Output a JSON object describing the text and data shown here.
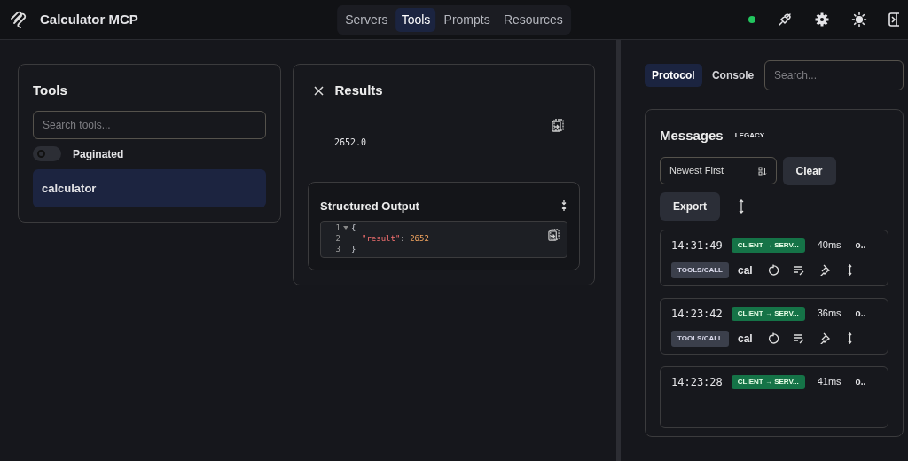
{
  "app": {
    "title": "Calculator MCP"
  },
  "nav_tabs": [
    {
      "label": "Servers",
      "selected": false
    },
    {
      "label": "Tools",
      "selected": true
    },
    {
      "label": "Prompts",
      "selected": false
    },
    {
      "label": "Resources",
      "selected": false
    }
  ],
  "connection": {
    "connected": true
  },
  "tools_panel": {
    "title": "Tools",
    "search": {
      "placeholder": "Search tools..."
    },
    "paginated": {
      "label": "Paginated",
      "on": false
    },
    "items": [
      {
        "label": "calculator",
        "selected": true
      }
    ]
  },
  "results_panel": {
    "title": "Results",
    "text_output": "2652.0",
    "structured_output": {
      "title": "Structured Output",
      "lines": [
        {
          "number": "1",
          "foldable": true,
          "tokens": [
            {
              "kind": "brace",
              "text": "{"
            }
          ]
        },
        {
          "number": "2",
          "foldable": false,
          "tokens": [
            {
              "kind": "key",
              "text": "\"result\""
            },
            {
              "kind": "punct",
              "text": ": "
            },
            {
              "kind": "number",
              "text": "2652"
            }
          ]
        },
        {
          "number": "3",
          "foldable": false,
          "tokens": [
            {
              "kind": "brace",
              "text": "}"
            }
          ]
        }
      ]
    }
  },
  "side_tabs": [
    {
      "label": "Protocol",
      "selected": true
    },
    {
      "label": "Console",
      "selected": false
    }
  ],
  "side_search": {
    "placeholder": "Search..."
  },
  "messages": {
    "title": "Messages",
    "badge": "LEGACY",
    "sort": "Newest First",
    "buttons": [
      "Clear",
      "Export"
    ],
    "items": [
      {
        "time": "14:31:49",
        "direction": "CLIENT → SERV...",
        "duration": "40ms",
        "extra": "o..",
        "method": "TOOLS/CALL",
        "name": "cal"
      },
      {
        "time": "14:23:42",
        "direction": "CLIENT → SERV...",
        "duration": "36ms",
        "extra": "o..",
        "method": "TOOLS/CALL",
        "name": "cal"
      },
      {
        "time": "14:23:28",
        "direction": "CLIENT → SERV...",
        "duration": "41ms",
        "extra": "o.."
      }
    ]
  }
}
